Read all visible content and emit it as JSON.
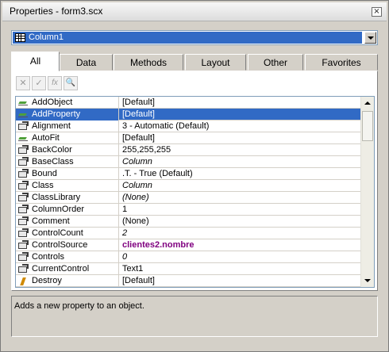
{
  "window": {
    "title": "Properties - form3.scx",
    "close_label": "×"
  },
  "object_combo": {
    "selected": "Column1",
    "icon": "grid-icon"
  },
  "tabs": [
    {
      "label": "All",
      "active": true
    },
    {
      "label": "Data",
      "active": false
    },
    {
      "label": "Methods",
      "active": false
    },
    {
      "label": "Layout",
      "active": false
    },
    {
      "label": "Other",
      "active": false
    },
    {
      "label": "Favorites",
      "active": false
    }
  ],
  "toolbar": [
    {
      "name": "cancel-icon",
      "glyph": "✕"
    },
    {
      "name": "accept-icon",
      "glyph": "✓"
    },
    {
      "name": "function-icon",
      "glyph": "fx"
    },
    {
      "name": "zoom-icon",
      "glyph": "🔍"
    }
  ],
  "properties": [
    {
      "name": "AddObject",
      "value": "[Default]",
      "kind": "method",
      "style": "normal"
    },
    {
      "name": "AddProperty",
      "value": "[Default]",
      "kind": "method",
      "style": "normal",
      "selected": true
    },
    {
      "name": "Alignment",
      "value": "3 - Automatic (Default)",
      "kind": "prop",
      "style": "normal"
    },
    {
      "name": "AutoFit",
      "value": "[Default]",
      "kind": "method",
      "style": "normal"
    },
    {
      "name": "BackColor",
      "value": "255,255,255",
      "kind": "prop",
      "style": "normal"
    },
    {
      "name": "BaseClass",
      "value": "Column",
      "kind": "prop",
      "style": "italic"
    },
    {
      "name": "Bound",
      "value": ".T. - True (Default)",
      "kind": "prop",
      "style": "normal"
    },
    {
      "name": "Class",
      "value": "Column",
      "kind": "prop",
      "style": "italic"
    },
    {
      "name": "ClassLibrary",
      "value": "(None)",
      "kind": "prop",
      "style": "italic"
    },
    {
      "name": "ColumnOrder",
      "value": "1",
      "kind": "prop",
      "style": "normal"
    },
    {
      "name": "Comment",
      "value": "(None)",
      "kind": "prop",
      "style": "normal"
    },
    {
      "name": "ControlCount",
      "value": "2",
      "kind": "prop",
      "style": "italic"
    },
    {
      "name": "ControlSource",
      "value": "clientes2.nombre",
      "kind": "prop",
      "style": "bold-purple"
    },
    {
      "name": "Controls",
      "value": "0",
      "kind": "prop",
      "style": "italic"
    },
    {
      "name": "CurrentControl",
      "value": "Text1",
      "kind": "prop",
      "style": "normal"
    },
    {
      "name": "Destroy",
      "value": "[Default]",
      "kind": "event",
      "style": "normal"
    }
  ],
  "description": "Adds a new property to an object.",
  "colors": {
    "selection": "#316ac5",
    "non_default_value": "#800080"
  }
}
